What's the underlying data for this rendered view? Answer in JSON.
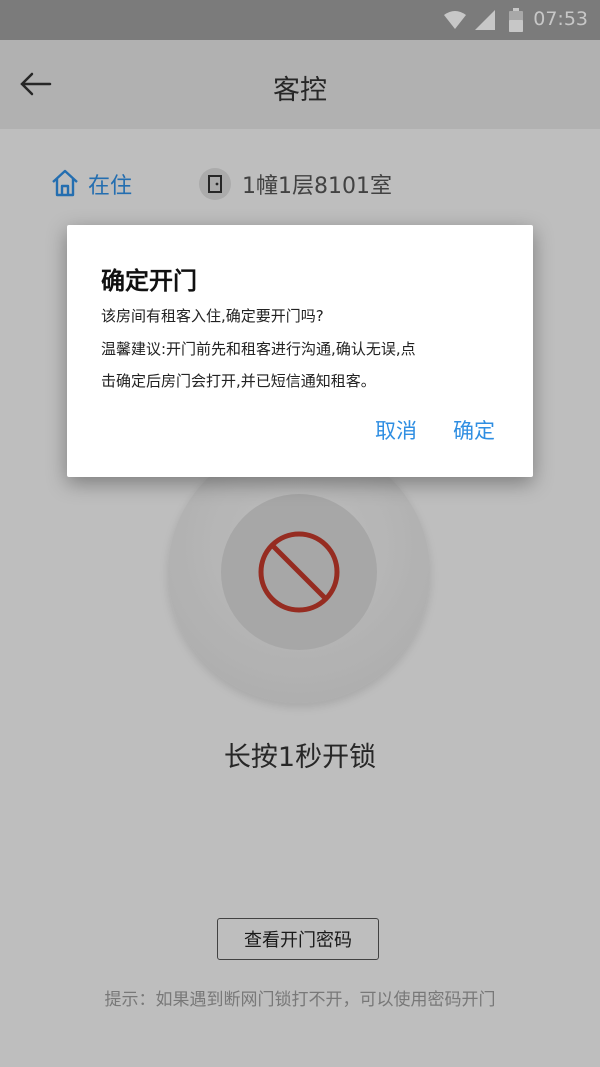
{
  "status_bar": {
    "time": "07:53",
    "icons": [
      "wifi-icon",
      "cellular-icon",
      "battery-icon"
    ]
  },
  "app_bar": {
    "title": "客控",
    "back_icon": "arrow-left-icon"
  },
  "room": {
    "status": "在住",
    "room_name": "1幢1层8101室"
  },
  "lock": {
    "hint": "长按1秒开锁",
    "icon": "no-entry-icon"
  },
  "password_button": "查看开门密码",
  "tip": "提示：如果遇到断网门锁打不开，可以使用密码开门",
  "dialog": {
    "title": "确定开门",
    "message_line1": "该房间有租客入住,确定要开门吗?",
    "message_line2": "温馨建议:开门前先和租客进行沟通,确认无误,点",
    "message_line3": "击确定后房门会打开,并已短信通知租客。",
    "cancel": "取消",
    "ok": "确定"
  },
  "colors": {
    "accent": "#2f8ee2",
    "danger": "#c0392b"
  }
}
